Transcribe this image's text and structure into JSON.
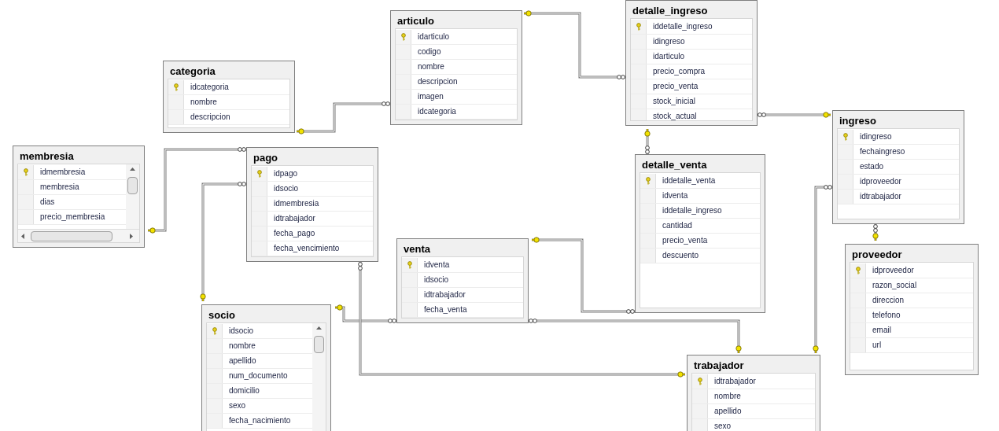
{
  "tables": [
    {
      "name": "categoria",
      "columns": [
        {
          "name": "idcategoria",
          "primary_key": true
        },
        {
          "name": "nombre",
          "primary_key": false
        },
        {
          "name": "descripcion",
          "primary_key": false
        }
      ]
    },
    {
      "name": "articulo",
      "columns": [
        {
          "name": "idarticulo",
          "primary_key": true
        },
        {
          "name": "codigo",
          "primary_key": false
        },
        {
          "name": "nombre",
          "primary_key": false
        },
        {
          "name": "descripcion",
          "primary_key": false
        },
        {
          "name": "imagen",
          "primary_key": false
        },
        {
          "name": "idcategoria",
          "primary_key": false
        }
      ]
    },
    {
      "name": "detalle_ingreso",
      "columns": [
        {
          "name": "iddetalle_ingreso",
          "primary_key": true
        },
        {
          "name": "idingreso",
          "primary_key": false
        },
        {
          "name": "idarticulo",
          "primary_key": false
        },
        {
          "name": "precio_compra",
          "primary_key": false
        },
        {
          "name": "precio_venta",
          "primary_key": false
        },
        {
          "name": "stock_inicial",
          "primary_key": false
        },
        {
          "name": "stock_actual",
          "primary_key": false
        }
      ]
    },
    {
      "name": "membresia",
      "columns": [
        {
          "name": "idmembresia",
          "primary_key": true
        },
        {
          "name": "membresia",
          "primary_key": false
        },
        {
          "name": "dias",
          "primary_key": false
        },
        {
          "name": "precio_membresia",
          "primary_key": false
        }
      ]
    },
    {
      "name": "pago",
      "columns": [
        {
          "name": "idpago",
          "primary_key": true
        },
        {
          "name": "idsocio",
          "primary_key": false
        },
        {
          "name": "idmembresia",
          "primary_key": false
        },
        {
          "name": "idtrabajador",
          "primary_key": false
        },
        {
          "name": "fecha_pago",
          "primary_key": false
        },
        {
          "name": "fecha_vencimiento",
          "primary_key": false
        }
      ]
    },
    {
      "name": "detalle_venta",
      "columns": [
        {
          "name": "iddetalle_venta",
          "primary_key": true
        },
        {
          "name": "idventa",
          "primary_key": false
        },
        {
          "name": "iddetalle_ingreso",
          "primary_key": false
        },
        {
          "name": "cantidad",
          "primary_key": false
        },
        {
          "name": "precio_venta",
          "primary_key": false
        },
        {
          "name": "descuento",
          "primary_key": false
        }
      ]
    },
    {
      "name": "ingreso",
      "columns": [
        {
          "name": "idingreso",
          "primary_key": true
        },
        {
          "name": "fechaingreso",
          "primary_key": false
        },
        {
          "name": "estado",
          "primary_key": false
        },
        {
          "name": "idproveedor",
          "primary_key": false
        },
        {
          "name": "idtrabajador",
          "primary_key": false
        }
      ]
    },
    {
      "name": "proveedor",
      "columns": [
        {
          "name": "idproveedor",
          "primary_key": true
        },
        {
          "name": "razon_social",
          "primary_key": false
        },
        {
          "name": "direccion",
          "primary_key": false
        },
        {
          "name": "telefono",
          "primary_key": false
        },
        {
          "name": "email",
          "primary_key": false
        },
        {
          "name": "url",
          "primary_key": false
        }
      ]
    },
    {
      "name": "venta",
      "columns": [
        {
          "name": "idventa",
          "primary_key": true
        },
        {
          "name": "idsocio",
          "primary_key": false
        },
        {
          "name": "idtrabajador",
          "primary_key": false
        },
        {
          "name": "fecha_venta",
          "primary_key": false
        }
      ]
    },
    {
      "name": "socio",
      "columns": [
        {
          "name": "idsocio",
          "primary_key": true
        },
        {
          "name": "nombre",
          "primary_key": false
        },
        {
          "name": "apellido",
          "primary_key": false
        },
        {
          "name": "num_documento",
          "primary_key": false
        },
        {
          "name": "domicilio",
          "primary_key": false
        },
        {
          "name": "sexo",
          "primary_key": false
        },
        {
          "name": "fecha_nacimiento",
          "primary_key": false
        }
      ]
    },
    {
      "name": "trabajador",
      "columns": [
        {
          "name": "idtrabajador",
          "primary_key": true
        },
        {
          "name": "nombre",
          "primary_key": false
        },
        {
          "name": "apellido",
          "primary_key": false
        },
        {
          "name": "sexo",
          "primary_key": false
        }
      ]
    }
  ]
}
